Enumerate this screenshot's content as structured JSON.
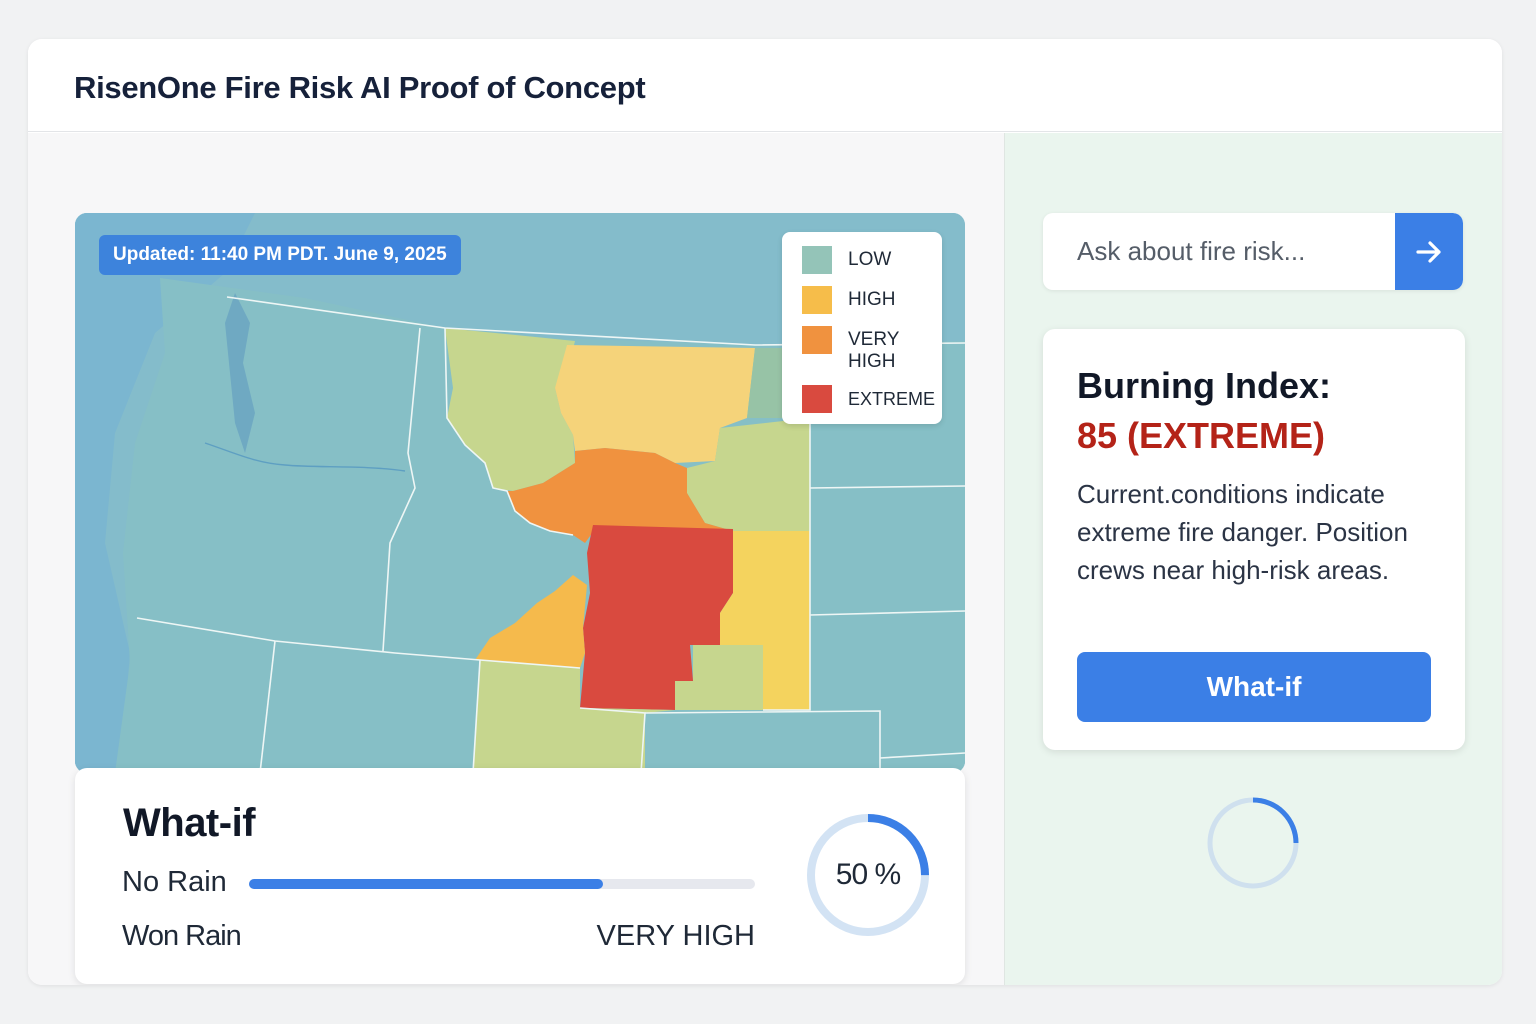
{
  "header": {
    "title": "RisenOne Fire Risk AI Proof of Concept"
  },
  "map": {
    "updated": "Updated: 11:40 PM PDT. June 9, 2025",
    "legend": [
      {
        "label": "LOW",
        "color": "#94c4b8"
      },
      {
        "label": "HIGH",
        "color": "#f6bd4a"
      },
      {
        "label": "VERY HIGH",
        "color": "#f0923f"
      },
      {
        "label": "EXTREME",
        "color": "#d94a3f"
      }
    ]
  },
  "whatif_panel": {
    "title": "What-if",
    "no_rain_label": "No Rain",
    "won_rain_label": "Won Rain",
    "risk_label": "VERY HIGH",
    "slider_fraction": 0.7,
    "donut_percent_label": "50 %",
    "donut_fraction": 0.25
  },
  "chat": {
    "placeholder": "Ask about fire risk..."
  },
  "burning_index": {
    "title": "Burning Index:",
    "value": "85 (EXTREME)",
    "description": "Current.conditions indicate extreme fire danger. Position crews near high-risk areas.",
    "button_label": "What-if"
  },
  "colors": {
    "accent": "#3b7fe6",
    "extreme_text": "#b42318",
    "map_background": "#84bccb"
  }
}
